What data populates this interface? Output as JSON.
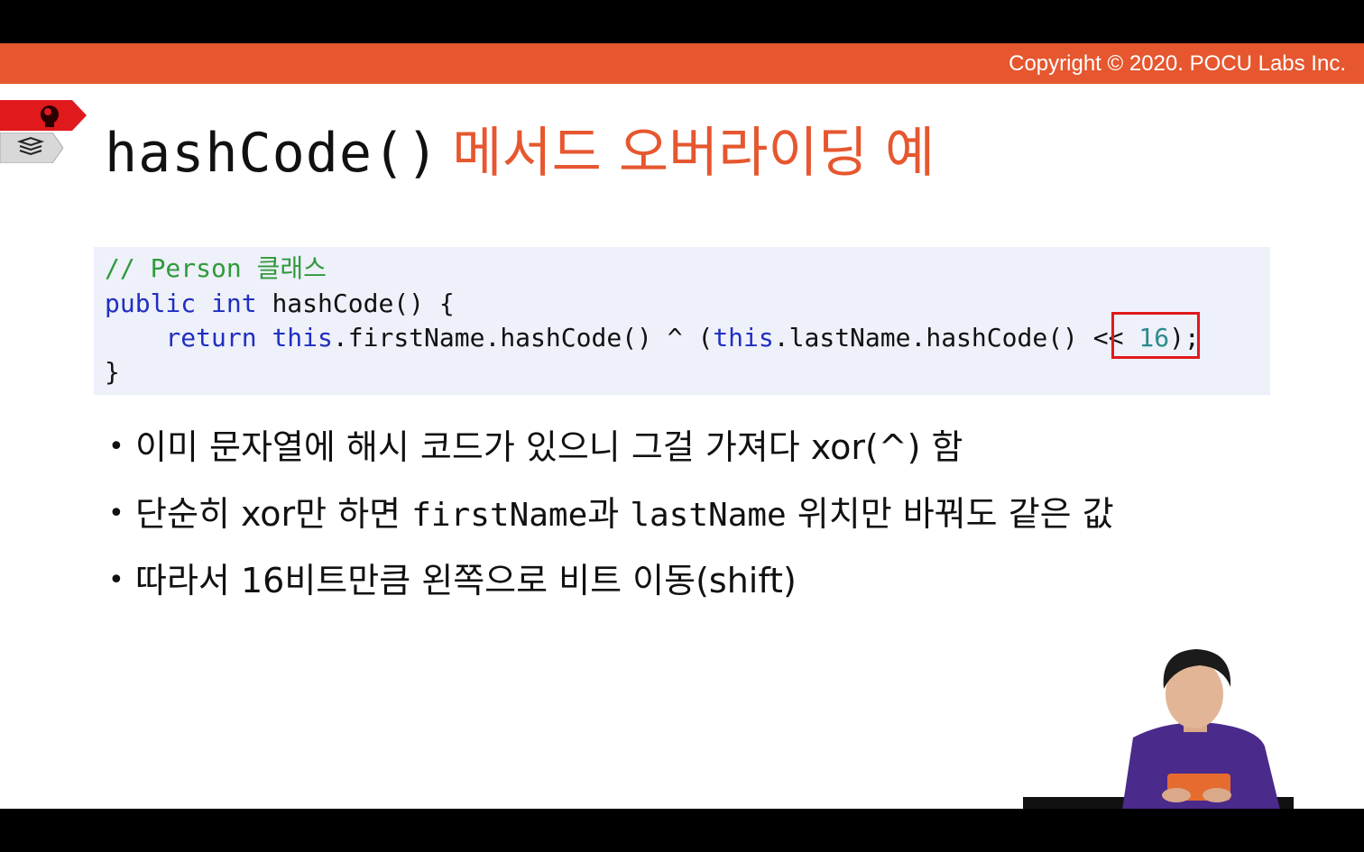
{
  "header": {
    "copyright": "Copyright © 2020. POCU Labs Inc."
  },
  "title": {
    "code": "hashCode()",
    "text": "메서드 오버라이딩 예"
  },
  "code": {
    "comment": "// Person 클래스",
    "line2_kw1": "public",
    "line2_kw2": "int",
    "line2_rest": " hashCode() {",
    "line3_indent": "    ",
    "line3_kw1": "return",
    "line3_kw2": "this",
    "line3_mid": ".firstName.hashCode() ^ (",
    "line3_kw3": "this",
    "line3_mid2": ".lastName.hashCode() << ",
    "line3_num": "16",
    "line3_end": ");",
    "line4": "}"
  },
  "bullets": {
    "b1": "이미 문자열에 해시 코드가 있으니 그걸 가져다 xor(^) 함",
    "b2_a": "단순히 xor만 하면 ",
    "b2_code1": "firstName",
    "b2_b": "과 ",
    "b2_code2": "lastName",
    "b2_c": " 위치만 바꿔도 같은 값",
    "b3": "따라서 16비트만큼 왼쪽으로 비트 이동(shift)"
  },
  "colors": {
    "accent": "#e6572f",
    "keyword": "#1f2fc0",
    "comment": "#2f9a3a",
    "number": "#2a8a8a",
    "highlight": "#e0191d"
  },
  "icons": {
    "side_top": "brain-head-icon",
    "side_bottom": "book-stack-icon"
  }
}
